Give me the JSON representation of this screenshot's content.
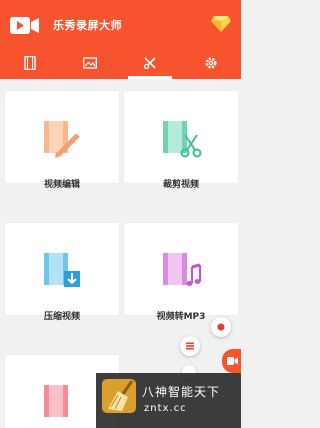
{
  "app": {
    "title": "乐秀录屏大师",
    "accent": "#f7532f"
  },
  "tabs": [
    {
      "name": "video-list-tab",
      "icon": "film-strip-icon"
    },
    {
      "name": "gallery-tab",
      "icon": "image-icon"
    },
    {
      "name": "tools-tab",
      "icon": "tools-icon",
      "selected": true
    },
    {
      "name": "settings-tab",
      "icon": "gear-icon"
    }
  ],
  "tools": [
    {
      "label": "视频编辑",
      "icon": "video-edit-icon",
      "color": "#f9b890"
    },
    {
      "label": "裁剪视频",
      "icon": "video-trim-icon",
      "color": "#6fd3b4"
    },
    {
      "label": "压缩视频",
      "icon": "video-compress-icon",
      "color": "#6cc6ee"
    },
    {
      "label": "视频转MP3",
      "icon": "video-to-mp3-icon",
      "color": "#d98be0"
    }
  ],
  "overlay": {
    "line1": "八神智能天下",
    "line2": "zntx.cc"
  }
}
